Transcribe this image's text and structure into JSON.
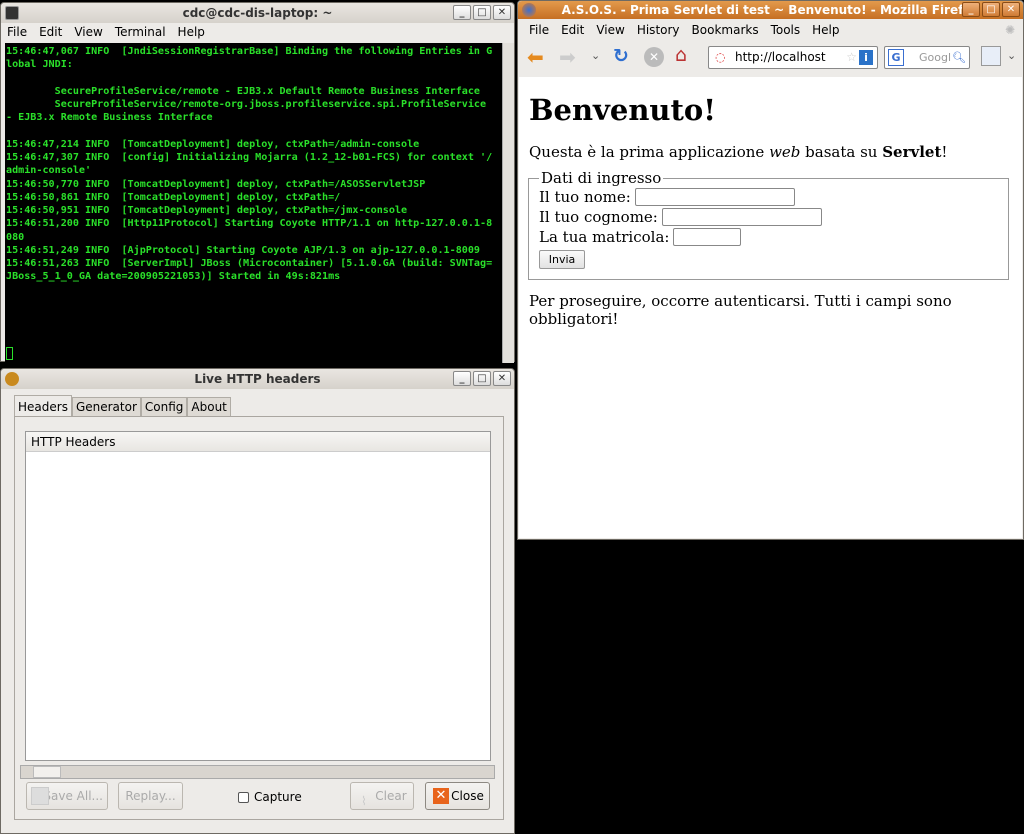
{
  "terminal": {
    "title": "cdc@cdc-dis-laptop: ~",
    "menu": [
      "File",
      "Edit",
      "View",
      "Terminal",
      "Help"
    ],
    "lines": [
      "15:46:47,067 INFO  [JndiSessionRegistrarBase] Binding the following Entries in G",
      "lobal JNDI:",
      "",
      "        SecureProfileService/remote - EJB3.x Default Remote Business Interface",
      "        SecureProfileService/remote-org.jboss.profileservice.spi.ProfileService",
      "- EJB3.x Remote Business Interface",
      "",
      "15:46:47,214 INFO  [TomcatDeployment] deploy, ctxPath=/admin-console",
      "15:46:47,307 INFO  [config] Initializing Mojarra (1.2_12-b01-FCS) for context '/",
      "admin-console'",
      "15:46:50,770 INFO  [TomcatDeployment] deploy, ctxPath=/ASOSServletJSP",
      "15:46:50,861 INFO  [TomcatDeployment] deploy, ctxPath=/",
      "15:46:50,951 INFO  [TomcatDeployment] deploy, ctxPath=/jmx-console",
      "15:46:51,200 INFO  [Http11Protocol] Starting Coyote HTTP/1.1 on http-127.0.0.1-8",
      "080",
      "15:46:51,249 INFO  [AjpProtocol] Starting Coyote AJP/1.3 on ajp-127.0.0.1-8009",
      "15:46:51,263 INFO  [ServerImpl] JBoss (Microcontainer) [5.1.0.GA (build: SVNTag=",
      "JBoss_5_1_0_GA date=200905221053)] Started in 49s:821ms"
    ]
  },
  "live": {
    "title": "Live HTTP headers",
    "tabs": [
      "Headers",
      "Generator",
      "Config",
      "About"
    ],
    "list_header": "HTTP Headers",
    "buttons": {
      "save": "Save All...",
      "replay": "Replay...",
      "capture": "Capture",
      "clear": "Clear",
      "close": "Close"
    },
    "capture_checked": false
  },
  "firefox": {
    "title": "A.S.O.S. - Prima Servlet di test ~ Benvenuto! - Mozilla Firefox",
    "menu": [
      "File",
      "Edit",
      "View",
      "History",
      "Bookmarks",
      "Tools",
      "Help"
    ],
    "url": "http://localhost",
    "search_placeholder": "Googl",
    "page": {
      "heading": "Benvenuto!",
      "intro_pre": "Questa è la prima applicazione ",
      "intro_em": "web",
      "intro_mid": " basata su ",
      "intro_strong": "Servlet",
      "intro_post": "!",
      "legend": "Dati di ingresso",
      "label_nome": "Il tuo nome:",
      "label_cognome": "Il tuo cognome:",
      "label_matricola": "La tua matricola:",
      "submit": "Invia",
      "footer": "Per proseguire, occorre autenticarsi. Tutti i campi sono obbligatori!"
    }
  },
  "colors": {
    "terminal_text": "#2ae02a",
    "firefox_title": "#d4803a"
  }
}
